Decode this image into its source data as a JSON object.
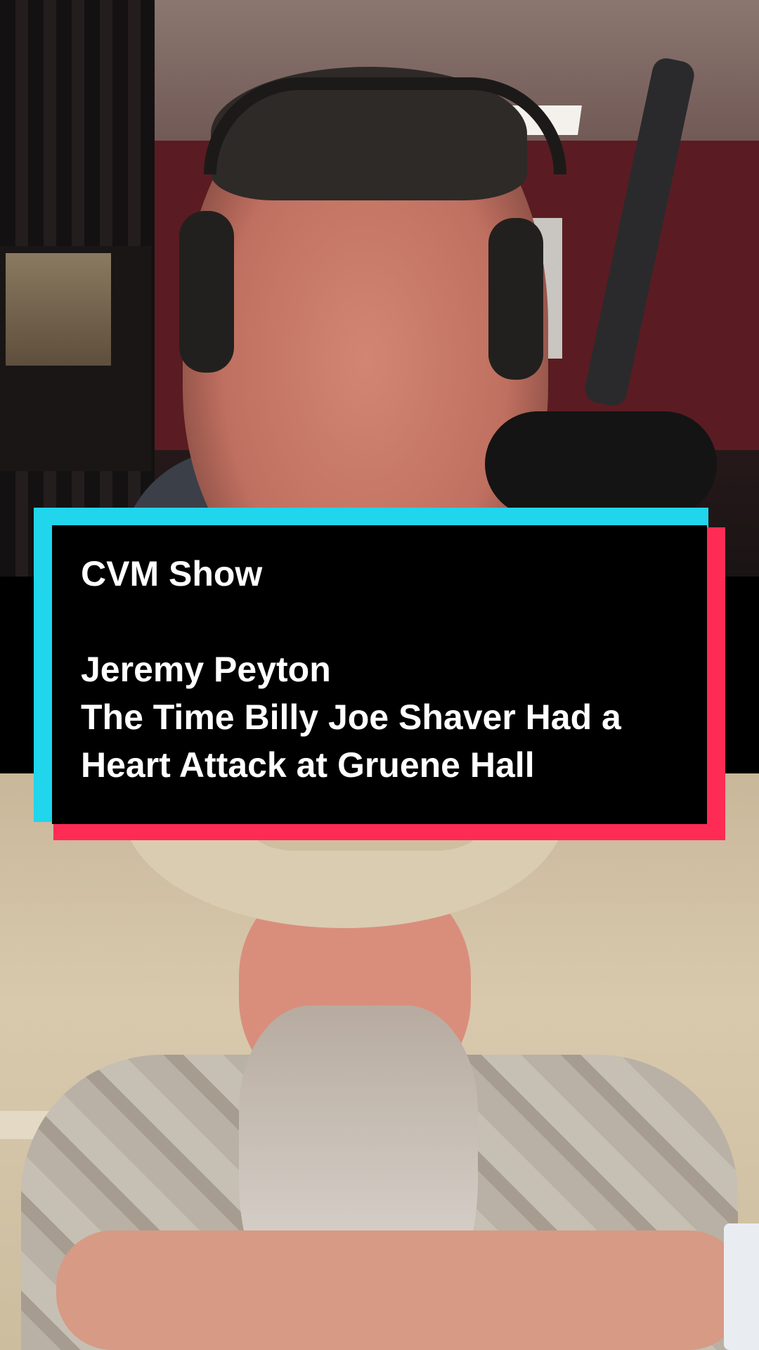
{
  "title_card": {
    "show_name": "CVM Show",
    "guest_name": "Jeremy Peyton",
    "episode_line_1": "The Time Billy Joe Shaver Had a",
    "episode_line_2": "Heart Attack at Gruene Hall"
  },
  "colors": {
    "card_background": "#000000",
    "card_accent_cyan": "#20d5ec",
    "card_accent_red": "#fe2c55",
    "card_text": "#ffffff"
  }
}
